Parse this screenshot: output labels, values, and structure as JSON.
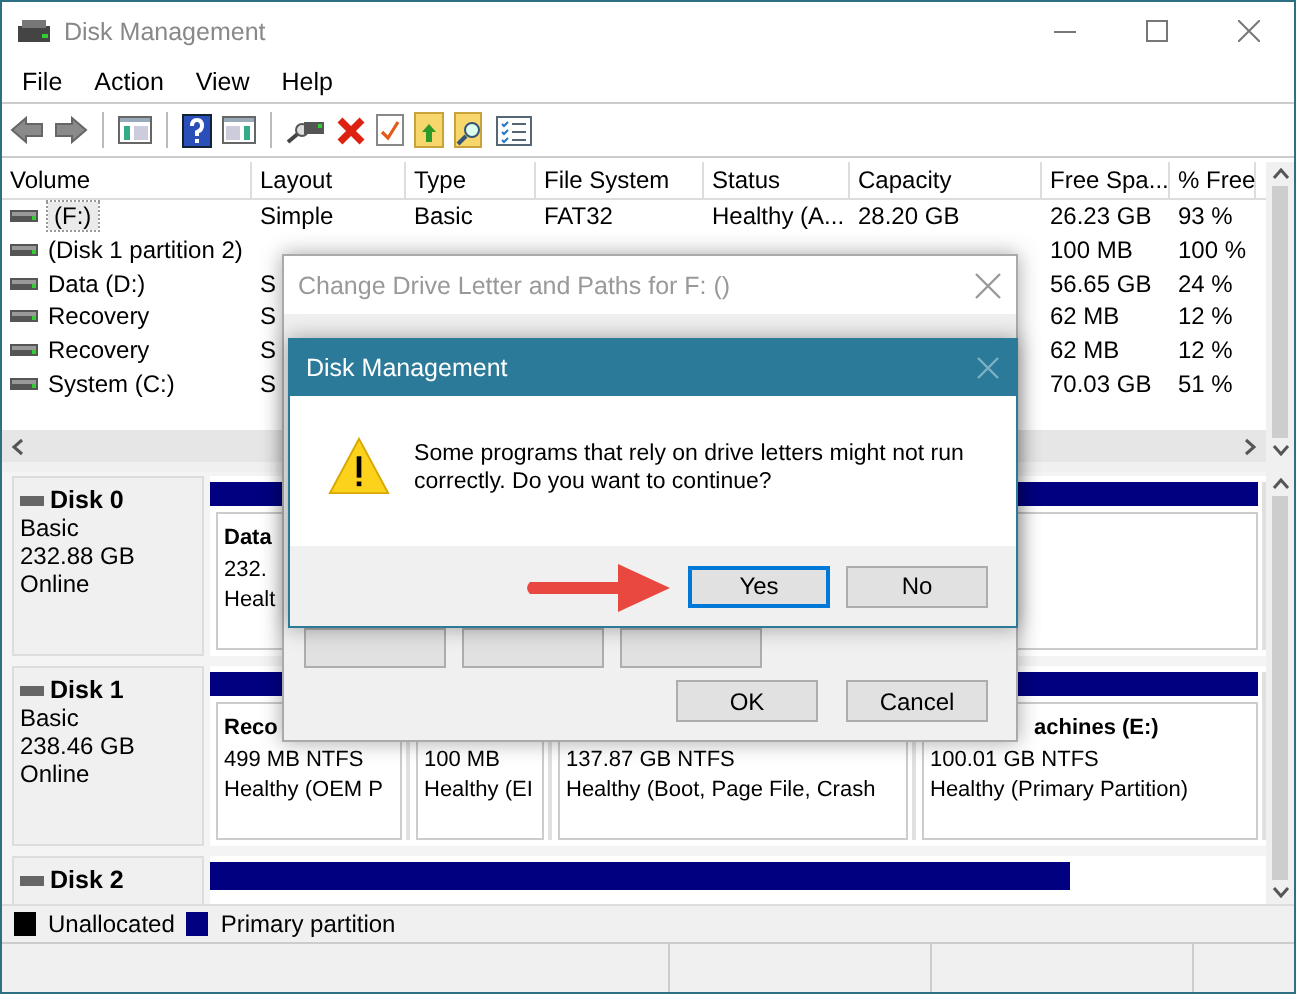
{
  "window": {
    "title": "Disk Management"
  },
  "menu": [
    {
      "label": "File"
    },
    {
      "label": "Action"
    },
    {
      "label": "View"
    },
    {
      "label": "Help"
    }
  ],
  "volumes": {
    "columns": [
      "Volume",
      "Layout",
      "Type",
      "File System",
      "Status",
      "Capacity",
      "Free Spa...",
      "% Free"
    ],
    "rows": [
      {
        "volume": "(F:)",
        "layout": "Simple",
        "type": "Basic",
        "file_system": "FAT32",
        "status": "Healthy (A...",
        "capacity": "28.20 GB",
        "free_space": "26.23 GB",
        "percent_free": "93 %",
        "selected": true
      },
      {
        "volume": "(Disk 1 partition 2)",
        "free_space": "100 MB",
        "percent_free": "100 %",
        "selected": false
      },
      {
        "volume": "Data (D:)",
        "layout": "S",
        "free_space": "56.65 GB",
        "percent_free": "24 %",
        "selected": false
      },
      {
        "volume": "Recovery",
        "layout": "S",
        "free_space": "62 MB",
        "percent_free": "12 %",
        "selected": false
      },
      {
        "volume": "Recovery",
        "layout": "S",
        "free_space": "62 MB",
        "percent_free": "12 %",
        "selected": false
      },
      {
        "volume": "System (C:)",
        "layout": "S",
        "free_space": "70.03 GB",
        "percent_free": "51 %",
        "selected": false
      }
    ]
  },
  "disks": [
    {
      "name": "Disk 0",
      "type": "Basic",
      "size": "232.88 GB",
      "status": "Online",
      "partitions": [
        {
          "label": "Data",
          "size": "232.",
          "status": "Healt"
        }
      ]
    },
    {
      "name": "Disk 1",
      "type": "Basic",
      "size": "238.46 GB",
      "status": "Online",
      "partitions": [
        {
          "label": "Reco",
          "size": "499 MB NTFS",
          "status": "Healthy (OEM P"
        },
        {
          "size": "100 MB",
          "status": "Healthy (EI"
        },
        {
          "size": "137.87 GB NTFS",
          "status": "Healthy (Boot, Page File, Crash"
        },
        {
          "label": "achines  (E:)",
          "size": "100.01 GB NTFS",
          "status": "Healthy (Primary Partition)"
        }
      ]
    },
    {
      "name": "Disk 2"
    }
  ],
  "legend": [
    {
      "label": "Unallocated",
      "color": "#000000"
    },
    {
      "label": "Primary partition",
      "color": "#000080"
    }
  ],
  "change_dialog": {
    "title": "Change Drive Letter and Paths for F: ()",
    "buttons": [
      {
        "label": "OK"
      },
      {
        "label": "Cancel"
      }
    ]
  },
  "confirm_dialog": {
    "title": "Disk Management",
    "message": "Some programs that rely on drive letters might not run correctly. Do you want to continue?",
    "buttons": [
      {
        "label": "Yes",
        "focused": true
      },
      {
        "label": "No",
        "focused": false
      }
    ]
  }
}
